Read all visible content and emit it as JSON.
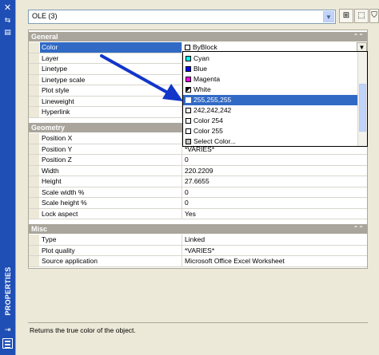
{
  "sidebar": {
    "title": "PROPERTIES",
    "close_glyph": "✕",
    "autohide_glyph": "⇆",
    "menu_glyph": "▤",
    "bottom_glyph": "⇥"
  },
  "selector": {
    "value": "OLE (3)",
    "arrow_glyph": "▼"
  },
  "toolbar": {
    "toggle_pickadd_glyph": "⊞",
    "select_objects_glyph": "⬚",
    "quick_select_glyph": "⛉"
  },
  "categories": {
    "general": "General",
    "geometry": "Geometry",
    "misc": "Misc",
    "collapse_glyph": "⌃⌃"
  },
  "general_rows": [
    {
      "name": "Color",
      "value": "ByBlock"
    },
    {
      "name": "Layer",
      "value": ""
    },
    {
      "name": "Linetype",
      "value": ""
    },
    {
      "name": "Linetype scale",
      "value": ""
    },
    {
      "name": "Plot style",
      "value": ""
    },
    {
      "name": "Lineweight",
      "value": ""
    },
    {
      "name": "Hyperlink",
      "value": ""
    }
  ],
  "geometry_rows": [
    {
      "name": "Position X",
      "value": ""
    },
    {
      "name": "Position Y",
      "value": "*VARIES*"
    },
    {
      "name": "Position Z",
      "value": "0"
    },
    {
      "name": "Width",
      "value": "220.2209"
    },
    {
      "name": "Height",
      "value": "27.6655"
    },
    {
      "name": "Scale width  %",
      "value": "0"
    },
    {
      "name": "Scale height  %",
      "value": "0"
    },
    {
      "name": "Lock aspect",
      "value": "Yes"
    }
  ],
  "misc_rows": [
    {
      "name": "Type",
      "value": "Linked"
    },
    {
      "name": "Plot quality",
      "value": "*VARIES*"
    },
    {
      "name": "Source application",
      "value": "Microsoft Office Excel Worksheet"
    }
  ],
  "color_dropdown": {
    "options": [
      {
        "label": "Cyan",
        "swatch": "#00ffff"
      },
      {
        "label": "Blue",
        "swatch": "#0000ff"
      },
      {
        "label": "Magenta",
        "swatch": "#ff00ff"
      },
      {
        "label": "White",
        "swatch": "#ffffff"
      },
      {
        "label": "255,255,255",
        "swatch": "#ffffff",
        "highlighted": true
      },
      {
        "label": "242,242,242",
        "swatch": "#f2f2f2"
      },
      {
        "label": "Color 254",
        "swatch": "#f4f4f4"
      },
      {
        "label": "Color 255",
        "swatch": "#ffffff"
      },
      {
        "label": "Select Color...",
        "swatch": "#c0c0c0"
      }
    ]
  },
  "description": "Returns the true color of the object.",
  "colors": {
    "selection": "#316ac5",
    "sidebar": "#1f4fb5",
    "annotation_arrow": "#1236c8",
    "category_bar": "#a9a59c"
  }
}
